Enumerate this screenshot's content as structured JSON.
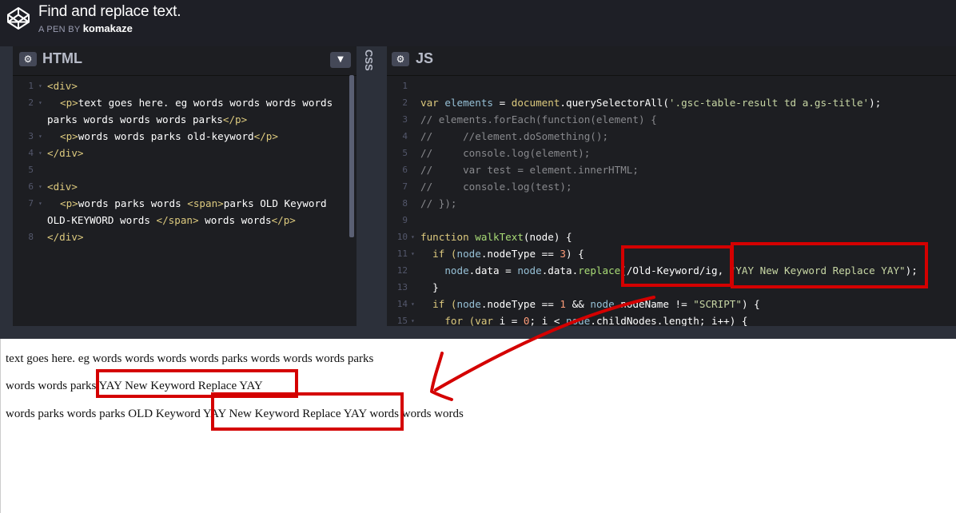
{
  "header": {
    "title": "Find and replace text.",
    "byline_prefix": "A PEN BY",
    "author": "komakaze"
  },
  "html_panel": {
    "name": "HTML",
    "lines": [
      "1",
      "2",
      "",
      "3",
      "4",
      "5",
      "6",
      "7",
      "",
      "8"
    ]
  },
  "css_panel": {
    "name": "CSS"
  },
  "js_panel": {
    "name": "JS",
    "line_numbers": [
      "1",
      "2",
      "3",
      "4",
      "5",
      "6",
      "7",
      "8",
      "9",
      "10",
      "11",
      "12",
      "13",
      "14",
      "15"
    ],
    "code": {
      "l2_var": "var",
      "l2_name": " elements ",
      "l2_eq": "= ",
      "l2_doc": "document",
      "l2_qs": ".querySelectorAll(",
      "l2_str": "'.gsc-table-result td a.gs-title'",
      "l2_end": ");",
      "l3": "// elements.forEach(function(element) {",
      "l4": "//     //element.doSomething();",
      "l5": "//     console.log(element);",
      "l6": "//     var test = element.innerHTML;",
      "l7": "//     console.log(test);",
      "l8": "// });",
      "l10_kw": "function",
      "l10_name": " walkText",
      "l10_args": "(node) {",
      "l11_a": "  if (",
      "l11_b": "node",
      "l11_c": ".nodeType == ",
      "l11_num": "3",
      "l11_d": ") {",
      "l12_a": "    node",
      "l12_b": ".data = ",
      "l12_c": "node",
      "l12_d": ".data.",
      "l12_fn": "replace",
      "l12_re": "(/Old-Keyword/ig, ",
      "l12_str": "\"YAY New Keyword Replace YAY\"",
      "l12_end": ");",
      "l13": "  }",
      "l14_a": "  if (",
      "l14_b": "node",
      "l14_c": ".nodeType == ",
      "l14_num": "1",
      "l14_d": " && ",
      "l14_e": "node",
      "l14_f": ".nodeName != ",
      "l14_str": "\"SCRIPT\"",
      "l14_g": ") {",
      "l15_a": "    for (",
      "l15_b": "var",
      "l15_c": " i = ",
      "l15_num": "0",
      "l15_d": "; i < ",
      "l15_e": "node",
      "l15_f": ".childNodes.length; i++) {"
    }
  },
  "html_code": {
    "l1": "<div>",
    "l2_open": "<p>",
    "l2_text": "text goes here. eg words words words words",
    "l2b_text": "parks words words words parks",
    "l2b_close": "</p>",
    "l3_open": "<p>",
    "l3_text": "words words parks old-keyword",
    "l3_close": "</p>",
    "l4": "</div>",
    "l6": "<div>",
    "l7_open": "<p>",
    "l7_text": "words parks words ",
    "l7_span": "<span>",
    "l7_text2": "parks OLD Keyword",
    "l7b_text": "OLD-KEYWORD words ",
    "l7b_span": "</span>",
    "l7b_text2": " words words",
    "l7b_close": "</p>",
    "l8": "</div>"
  },
  "preview": {
    "p1": "text goes here. eg words words words words parks words words words parks",
    "p2": "words words parks YAY New Keyword Replace YAY",
    "p3": "words parks words parks OLD Keyword YAY New Keyword Replace YAY words words words"
  },
  "colors": {
    "annotation": "#d40000",
    "editor_bg": "#1d1e22",
    "header_bg": "#1e1f26"
  }
}
